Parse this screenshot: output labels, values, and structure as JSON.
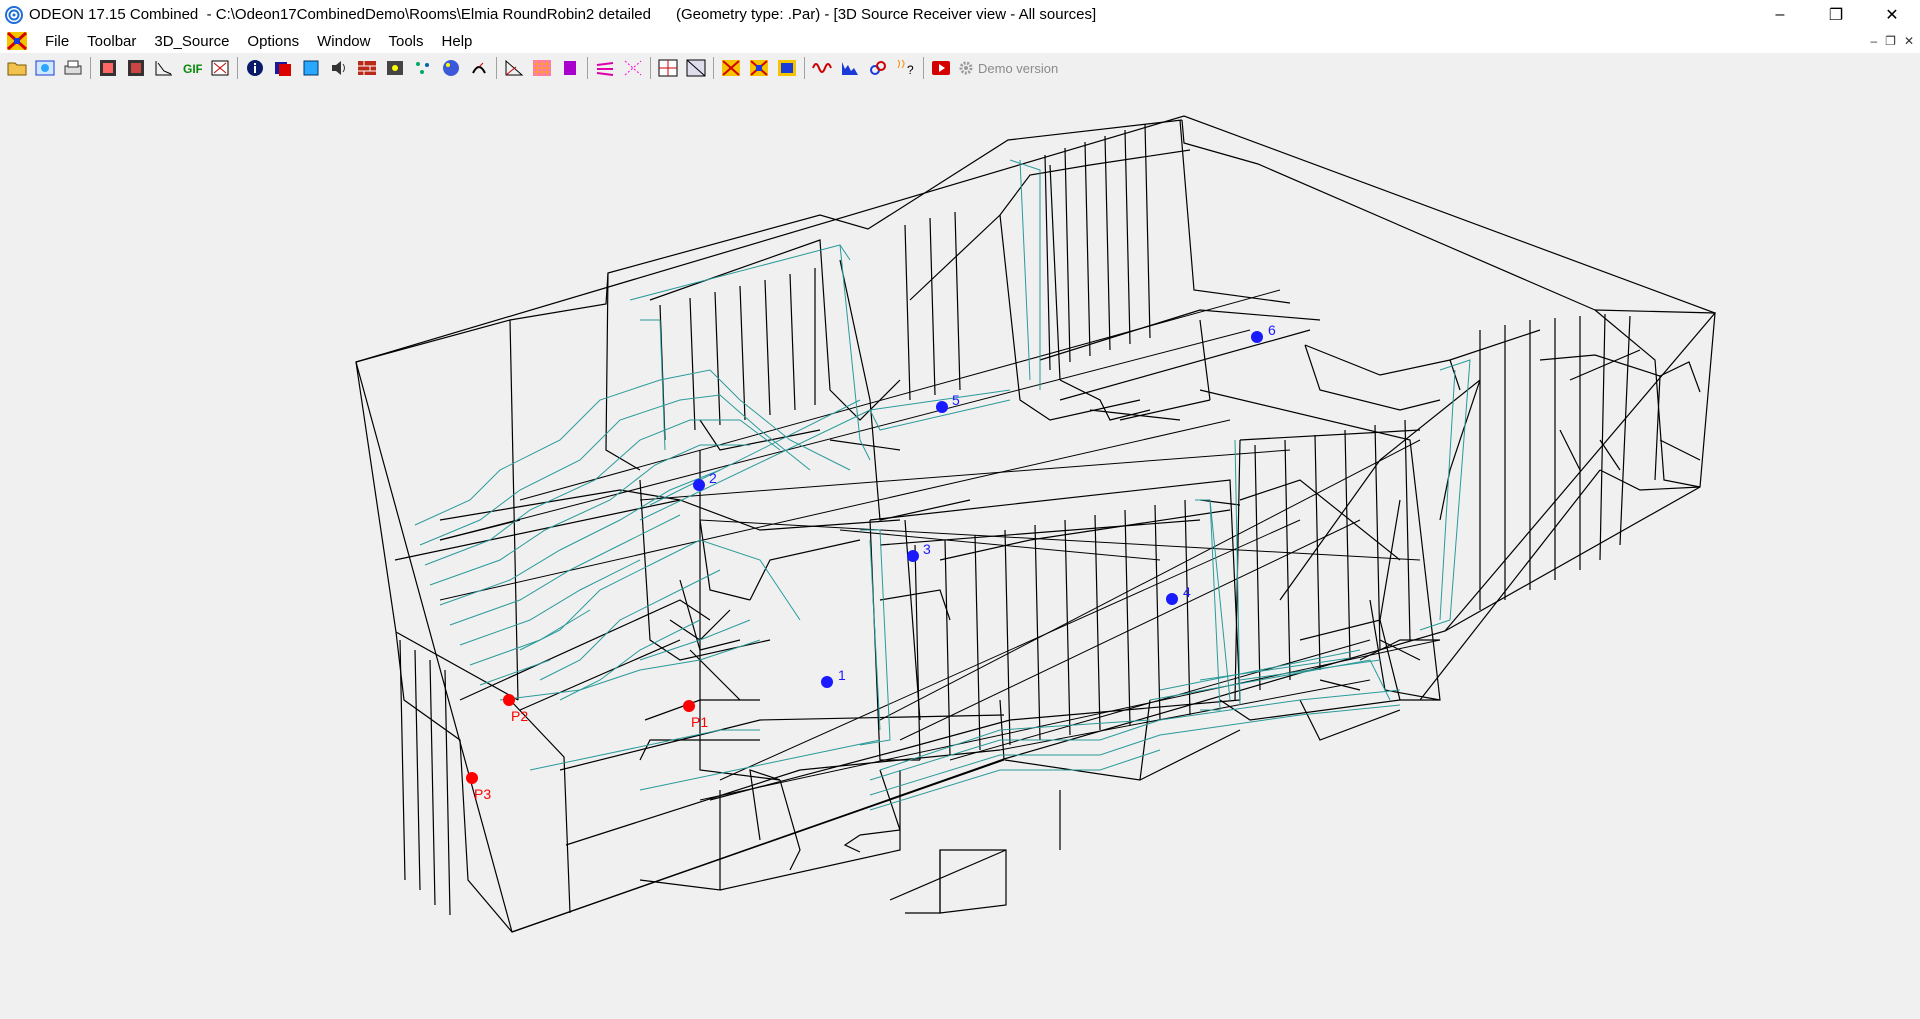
{
  "window": {
    "title": "ODEON 17.15 Combined  - C:\\Odeon17CombinedDemo\\Rooms\\Elmia RoundRobin2 detailed      (Geometry type: .Par) - [3D Source Receiver view - All sources]",
    "minimize": "–",
    "maximize": "❐",
    "close": "✕"
  },
  "menu": {
    "items": [
      "File",
      "Toolbar",
      "3D_Source",
      "Options",
      "Window",
      "Tools",
      "Help"
    ],
    "mdi_min": "–",
    "mdi_restore": "❐",
    "mdi_close": "✕"
  },
  "toolbar": {
    "demo_label": "Demo version"
  },
  "view": {
    "sources": [
      "1",
      "2",
      "3",
      "4",
      "5",
      "6"
    ],
    "receivers": [
      "P1",
      "P2",
      "P3"
    ],
    "colors": {
      "source": "#1a1aff",
      "receiver": "#ff0000",
      "audience": "#2a9a9a",
      "wireframe": "#000000"
    }
  }
}
